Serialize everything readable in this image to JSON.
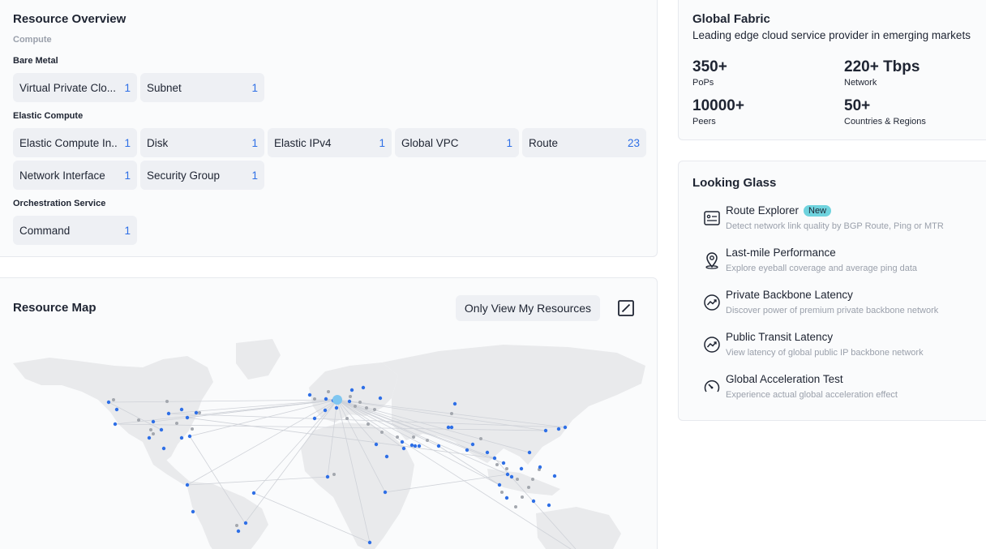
{
  "overview": {
    "title": "Resource Overview",
    "category": "Compute",
    "groups": [
      {
        "label": "Bare Metal",
        "items": [
          {
            "name": "Virtual Private Clo...",
            "count": "1"
          },
          {
            "name": "Subnet",
            "count": "1"
          }
        ]
      },
      {
        "label": "Elastic Compute",
        "items": [
          {
            "name": "Elastic Compute In...",
            "count": "1"
          },
          {
            "name": "Disk",
            "count": "1"
          },
          {
            "name": "Elastic IPv4",
            "count": "1"
          },
          {
            "name": "Global VPC",
            "count": "1"
          },
          {
            "name": "Route",
            "count": "23"
          },
          {
            "name": "Network Interface",
            "count": "1"
          },
          {
            "name": "Security Group",
            "count": "1"
          }
        ]
      },
      {
        "label": "Orchestration Service",
        "items": [
          {
            "name": "Command",
            "count": "1"
          }
        ]
      }
    ]
  },
  "map": {
    "title": "Resource Map",
    "only_view_label": "Only View My Resources",
    "expand_icon": "expand-icon",
    "colors": {
      "land": "#e9eaec",
      "own_node": "#2e6fe6",
      "other_node": "#a3a7ae",
      "hub": "#7fc6f0",
      "link": "#cfd2d8"
    }
  },
  "fabric": {
    "title": "Global Fabric",
    "subtitle": "Leading edge cloud service provider in emerging markets",
    "stats": [
      {
        "value": "350+",
        "label": "PoPs"
      },
      {
        "value": "220+ Tbps",
        "label": "Network"
      },
      {
        "value": "10000+",
        "label": "Peers"
      },
      {
        "value": "50+",
        "label": "Countries & Regions"
      }
    ]
  },
  "glass": {
    "title": "Looking Glass",
    "items": [
      {
        "title": "Route Explorer",
        "badge": "New",
        "desc": "Detect network link quality by BGP Route, Ping or MTR",
        "icon": "route-card-icon"
      },
      {
        "title": "Last-mile Performance",
        "desc": "Explore eyeball coverage and average ping data",
        "icon": "location-pin-icon"
      },
      {
        "title": "Private Backbone Latency",
        "desc": "Discover power of premium private backbone network",
        "icon": "trend-icon"
      },
      {
        "title": "Public Transit Latency",
        "desc": "View latency of global public IP backbone network",
        "icon": "trend-icon"
      },
      {
        "title": "Global Acceleration Test",
        "desc": "Experience actual global acceleration effect",
        "icon": "speedometer-icon"
      }
    ]
  }
}
